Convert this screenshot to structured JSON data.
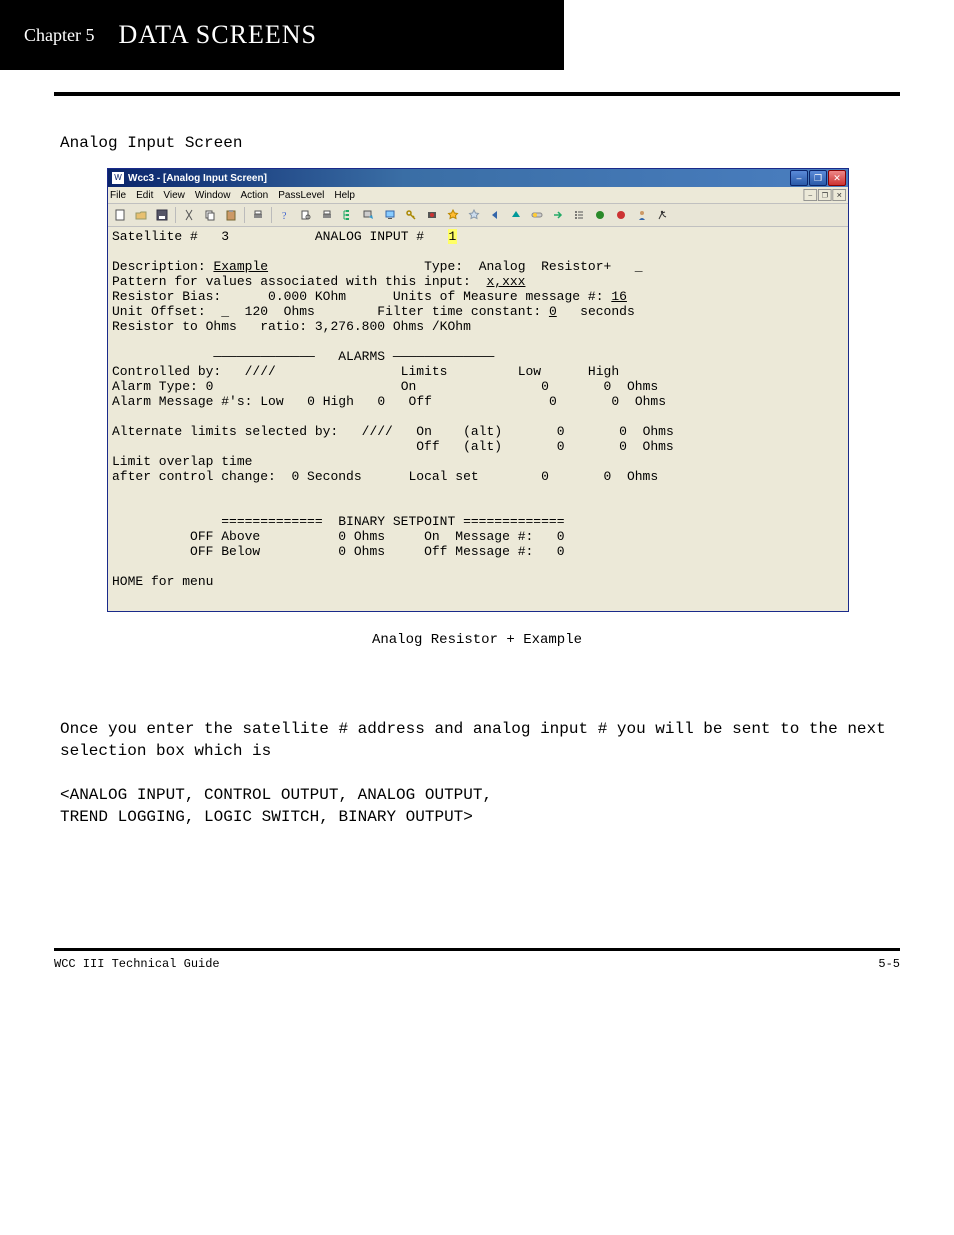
{
  "chapter": {
    "small": "Chapter 5",
    "big": "DATA SCREENS"
  },
  "intro": "Analog Input Screen",
  "appwin": {
    "title": "Wcc3 - [Analog Input Screen]",
    "menu": [
      "File",
      "Edit",
      "View",
      "Window",
      "Action",
      "PassLevel",
      "Help"
    ],
    "win_btns": {
      "min": "–",
      "max": "❐",
      "close": "✕"
    },
    "mdi_btns": {
      "min": "–",
      "max": "❐",
      "close": "✕"
    },
    "toolbar_semantics": [
      "new",
      "open",
      "save",
      "sep",
      "cut",
      "copy",
      "paste",
      "sep",
      "print",
      "sep",
      "help",
      "print-preview",
      "printer-2",
      "tree",
      "send",
      "screen",
      "key",
      "record",
      "star1",
      "star2",
      "nav-back",
      "nav-up",
      "toggle",
      "go",
      "bullets",
      "green-dot",
      "red-dot",
      "person",
      "run"
    ]
  },
  "c": {
    "line1": {
      "sat_lbl": "Satellite #",
      "sat_no": "3",
      "ai_lbl": "ANALOG INPUT #",
      "ai_no": "1"
    },
    "desc_lbl": "Description:",
    "desc_val": "Example",
    "type_lbl": "Type:",
    "type_val": "Analog  Resistor+",
    "pattern_lbl": "Pattern for values associated with this input:",
    "pattern_val": "x,xxx",
    "rbias_lbl": "Resistor Bias:",
    "rbias_val": "0.000 KOhm",
    "units_msg_lbl": "Units of Measure message #:",
    "units_msg_val": "16",
    "uoff_lbl": "Unit Offset:",
    "uoff_val": "120",
    "uoff_unit": "Ohms",
    "ftc_lbl": "Filter time constant:",
    "ftc_val": "0",
    "ftc_unit": "seconds",
    "ratio_lbl": "Resistor to Ohms   ratio:",
    "ratio_val": "3,276.800 Ohms /KOhm",
    "alarms_hdr": "ALARMS",
    "limits_hdr": "Limits",
    "low_hdr": "Low",
    "high_hdr": "High",
    "ctrl_by_lbl": "Controlled by:",
    "ctrl_by_val": "////",
    "alarm_type_lbl": "Alarm Type:",
    "alarm_type_val": "0",
    "amsg_lbl": "Alarm Message #'s:",
    "amsg_low_lbl": "Low",
    "amsg_low": "0",
    "amsg_high_lbl": "High",
    "amsg_high": "0",
    "on_lbl": "On",
    "off_lbl": "Off",
    "on_low": "0",
    "on_high": "0",
    "on_unit": "Ohms",
    "off_low": "0",
    "off_high": "0",
    "off_unit": "Ohms",
    "alt_sel_lbl": "Alternate limits selected by:",
    "alt_sel_val": "////",
    "on_alt_lbl": "On",
    "alt_tag": "(alt)",
    "on_alt_low": "0",
    "on_alt_high": "0",
    "on_alt_unit": "Ohms",
    "off_alt_lbl": "Off",
    "off_alt_low": "0",
    "off_alt_high": "0",
    "off_alt_unit": "Ohms",
    "overlap1": "Limit overlap time",
    "overlap2_lbl": "after control change:",
    "overlap2_val": "0 Seconds",
    "local_set_lbl": "Local set",
    "local_low": "0",
    "local_high": "0",
    "local_unit": "Ohms",
    "bsp_hdr": "BINARY SETPOINT",
    "bsp_above_lbl": "OFF Above",
    "bsp_above_val": "0 Ohms",
    "bsp_onmsg_lbl": "On  Message #:",
    "bsp_onmsg": "0",
    "bsp_below_lbl": "OFF Below",
    "bsp_below_val": "0 Ohms",
    "bsp_offmsg_lbl": "Off Message #:",
    "bsp_offmsg": "0",
    "home": "HOME for menu"
  },
  "caption": "Analog Resistor + Example",
  "para1": "Once you enter the satellite # address and analog input # you will be sent to the next selection box which is",
  "sel_line1": "<ANALOG INPUT, CONTROL OUTPUT, ANALOG OUTPUT,",
  "sel_line2": " TREND LOGGING, LOGIC SWITCH, BINARY OUTPUT>",
  "footer": {
    "left": "WCC III Technical Guide",
    "right": "5-5"
  }
}
